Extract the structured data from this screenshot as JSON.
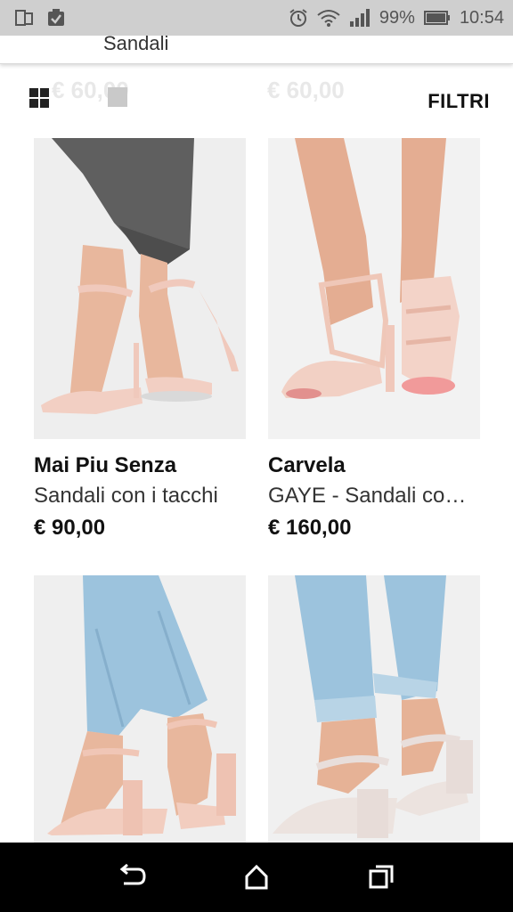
{
  "status_bar": {
    "battery": "99%",
    "time": "10:54",
    "icons": [
      "screen-mirror-icon",
      "clipboard-check-icon",
      "alarm-icon",
      "wifi-icon",
      "signal-icon",
      "battery-icon"
    ]
  },
  "header": {
    "title": "Sandali"
  },
  "toolbar": {
    "ghost_prices": [
      "€ 60,00",
      "€ 60,00"
    ],
    "filter_label": "FILTRI"
  },
  "products": [
    {
      "brand": "Mai Piu Senza",
      "name": "Sandali con i tacchi",
      "price": "€ 90,00"
    },
    {
      "brand": "Carvela",
      "name": "GAYE - Sandali co…",
      "price": "€ 160,00"
    },
    {
      "brand": "",
      "name": "",
      "price": ""
    },
    {
      "brand": "",
      "name": "",
      "price": ""
    }
  ],
  "colors": {
    "status_bar_bg": "#cfcfcf",
    "nav_bar_bg": "#000000",
    "jeans_grey": "#5f5f5f",
    "jeans_light_blue": "#9cc3dd",
    "shoe_nude": "#f2cfc3",
    "skin": "#e9b59a"
  }
}
